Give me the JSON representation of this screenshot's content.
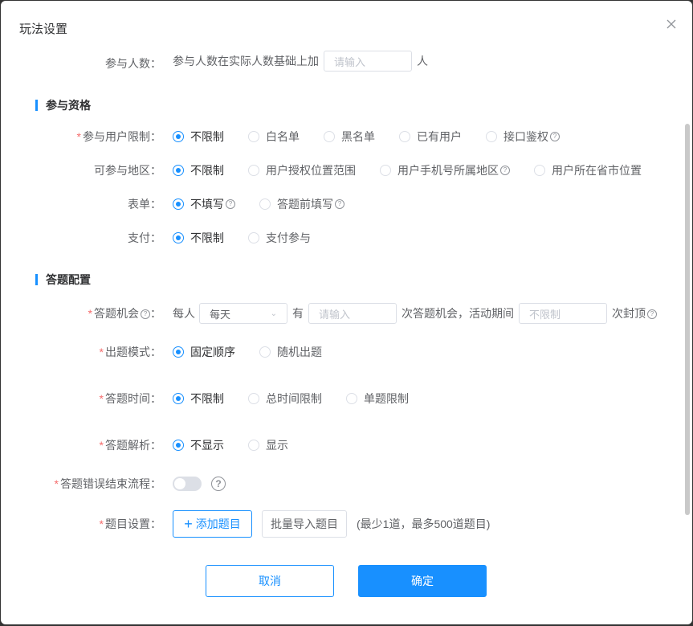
{
  "dialog": {
    "title": "玩法设置"
  },
  "top_row": {
    "label": "参与人数：",
    "text": "参与人数在实际人数基础上加",
    "input_placeholder": "请输入",
    "unit": "人"
  },
  "section_eligibility": {
    "title": "参与资格"
  },
  "user_limit": {
    "label": "参与用户限制：",
    "options": [
      "不限制",
      "白名单",
      "黑名单",
      "已有用户",
      "接口鉴权"
    ],
    "selected": "不限制"
  },
  "region": {
    "label": "可参与地区：",
    "options": [
      "不限制",
      "用户授权位置范围",
      "用户手机号所属地区",
      "用户所在省市位置"
    ],
    "selected": "不限制"
  },
  "form": {
    "label": "表单：",
    "options": [
      "不填写",
      "答题前填写"
    ],
    "selected": "不填写"
  },
  "payment": {
    "label": "支付：",
    "options": [
      "不限制",
      "支付参与"
    ],
    "selected": "不限制"
  },
  "section_quiz": {
    "title": "答题配置"
  },
  "chances": {
    "label": "答题机会",
    "prefix": "每人",
    "period_value": "每天",
    "mid": "有",
    "count_placeholder": "请输入",
    "suffix": "次答题机会，活动期间",
    "cap_placeholder": "不限制",
    "cap_suffix": "次封顶"
  },
  "mode": {
    "label": "出题模式：",
    "options": [
      "固定顺序",
      "随机出题"
    ],
    "selected": "固定顺序"
  },
  "time": {
    "label": "答题时间：",
    "options": [
      "不限制",
      "总时间限制",
      "单题限制"
    ],
    "selected": "不限制"
  },
  "analysis": {
    "label": "答题解析：",
    "options": [
      "不显示",
      "显示"
    ],
    "selected": "不显示"
  },
  "wrong_end": {
    "label": "答题错误结束流程：",
    "enabled": false
  },
  "questions": {
    "label": "题目设置：",
    "add_label": "添加题目",
    "import_label": "批量导入题目",
    "hint": "(最少1道，最多500道题目)"
  },
  "footer": {
    "cancel_label": "取消",
    "ok_label": "确定"
  },
  "colors": {
    "primary": "#1890ff",
    "required": "#f56c6c"
  },
  "icons": {
    "close": "close-icon",
    "help": "question-circle-icon",
    "chevron": "chevron-down-icon",
    "plus": "plus-icon"
  }
}
